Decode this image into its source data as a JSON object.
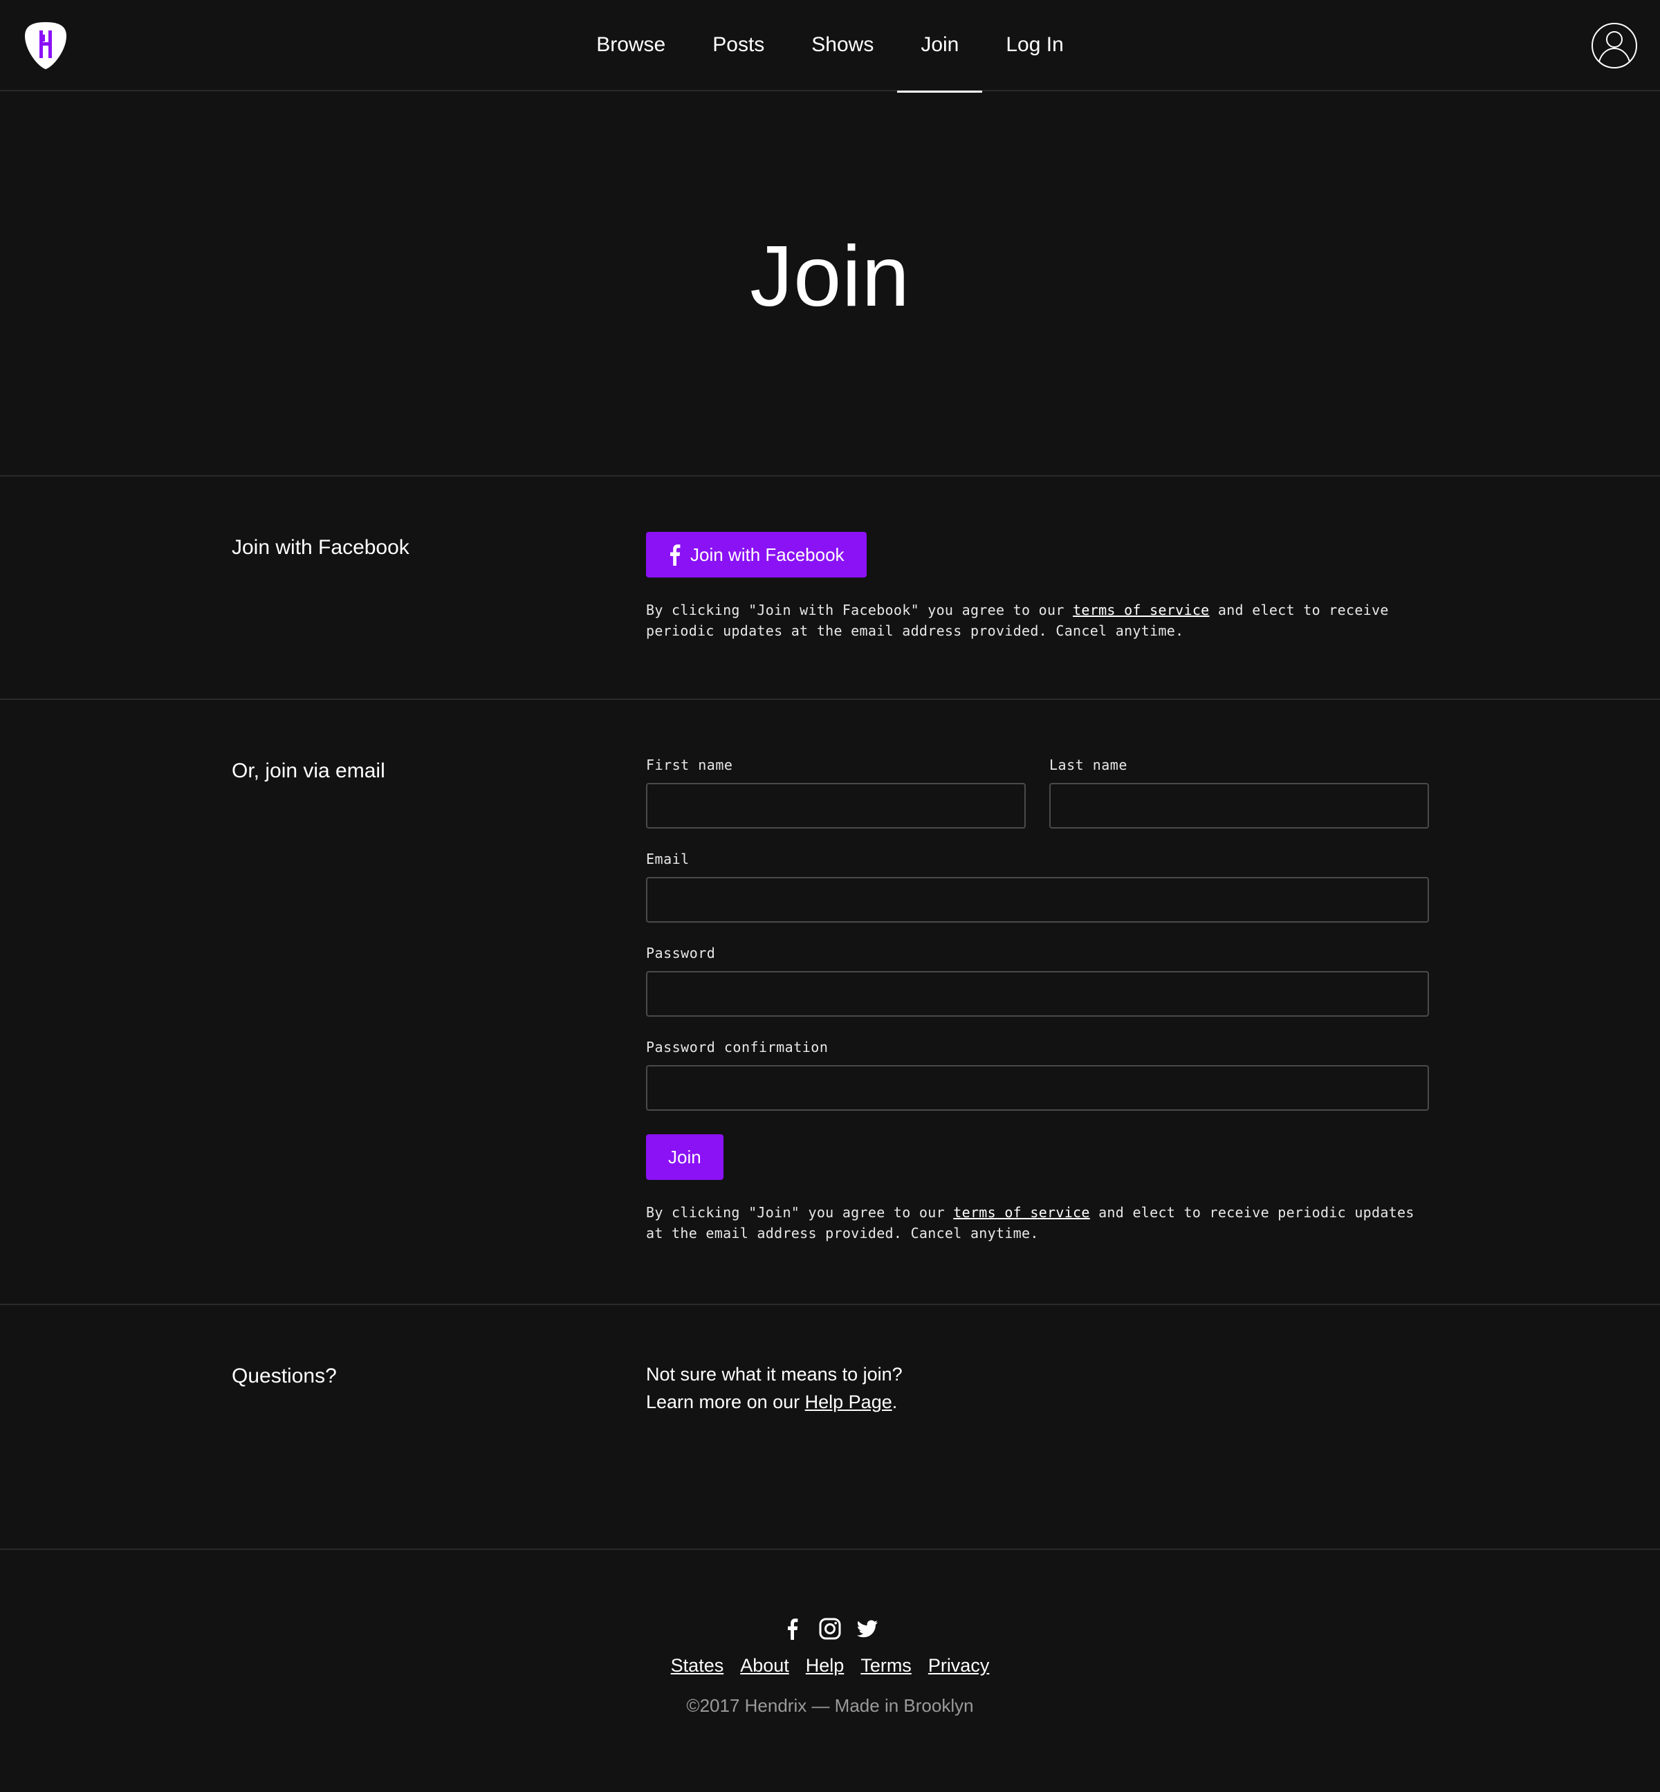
{
  "colors": {
    "background": "#121212",
    "accent": "#8b12f5",
    "divider": "#2a2a2a",
    "input_border": "#4a4a4a",
    "muted_text": "#9a9a9a"
  },
  "header": {
    "logo_icon": "hendrix-pick-logo",
    "nav": [
      {
        "label": "Browse",
        "active": false
      },
      {
        "label": "Posts",
        "active": false
      },
      {
        "label": "Shows",
        "active": false
      },
      {
        "label": "Join",
        "active": true
      },
      {
        "label": "Log In",
        "active": false
      }
    ],
    "avatar_icon": "user-avatar-icon"
  },
  "hero": {
    "title": "Join"
  },
  "facebook_section": {
    "label": "Join with Facebook",
    "button_label": "Join with Facebook",
    "button_icon": "facebook-icon",
    "disclaimer_before": "By clicking \"Join with Facebook\" you agree to our ",
    "disclaimer_link": "terms of service",
    "disclaimer_after": " and elect to receive periodic updates at the email address provided. Cancel anytime."
  },
  "email_section": {
    "label": "Or, join via email",
    "fields": {
      "first_name": {
        "label": "First name",
        "value": ""
      },
      "last_name": {
        "label": "Last name",
        "value": ""
      },
      "email": {
        "label": "Email",
        "value": ""
      },
      "password": {
        "label": "Password",
        "value": ""
      },
      "password_confirmation": {
        "label": "Password confirmation",
        "value": ""
      }
    },
    "submit_label": "Join",
    "disclaimer_before": "By clicking \"Join\" you agree to our ",
    "disclaimer_link": "terms of service",
    "disclaimer_after": " and elect to receive periodic updates at the email address provided. Cancel anytime."
  },
  "questions_section": {
    "label": "Questions?",
    "line1": "Not sure what it means to join?",
    "line2_before": "Learn more on our ",
    "line2_link": "Help Page",
    "line2_after": "."
  },
  "footer": {
    "social_icons": [
      "facebook-icon",
      "instagram-icon",
      "twitter-icon"
    ],
    "links": [
      "States",
      "About",
      "Help",
      "Terms",
      "Privacy"
    ],
    "copyright": "©2017 Hendrix — Made in Brooklyn"
  }
}
